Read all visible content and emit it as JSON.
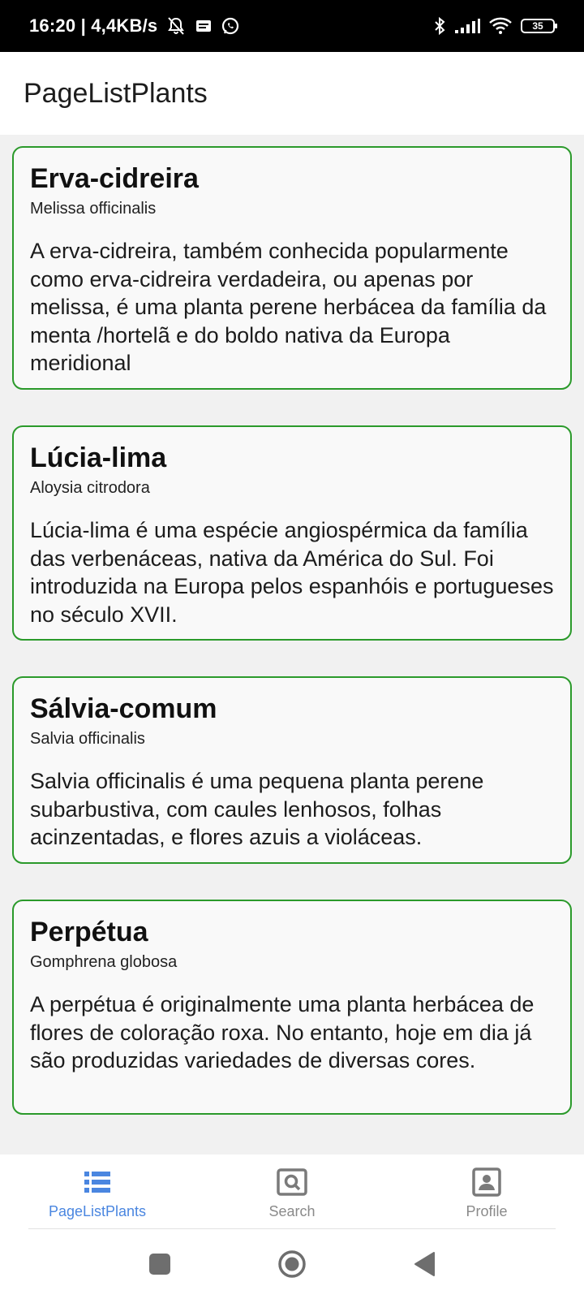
{
  "status_bar": {
    "time_speed": "16:20 | 4,4KB/s",
    "battery_level": "35",
    "icons": [
      "alarm-off-icon",
      "message-icon",
      "whatsapp-icon",
      "bluetooth-icon",
      "signal-icon",
      "wifi-icon",
      "battery-icon"
    ]
  },
  "app_bar": {
    "title": "PageListPlants"
  },
  "colors": {
    "card_border": "#2b9a2b",
    "active_tab": "#4a86e0",
    "inactive_tab": "#8a8a8a"
  },
  "plants": [
    {
      "name": "Erva-cidreira",
      "scientific": "Melissa officinalis",
      "description": "A erva-cidreira, também conhecida popularmente como erva-cidreira verdadeira, ou apenas por melissa, é uma planta perene herbácea da família da menta /hortelã e do boldo nativa da Europa meridional"
    },
    {
      "name": "Lúcia-lima",
      "scientific": "Aloysia citrodora",
      "description": "Lúcia-lima é uma espécie angiospérmica da família das verbenáceas, nativa da América do Sul. Foi introduzida na Europa pelos espanhóis e portugueses no século XVII."
    },
    {
      "name": "Sálvia-comum",
      "scientific": "Salvia officinalis",
      "description": "Salvia officinalis é uma pequena planta perene subarbustiva, com caules lenhosos, folhas acinzentadas, e flores azuis a violáceas."
    },
    {
      "name": "Perpétua",
      "scientific": "Gomphrena globosa",
      "description": "A perpétua é originalmente uma planta herbácea de flores de coloração roxa. No entanto, hoje em dia já são produzidas variedades de diversas cores."
    }
  ],
  "bottom_nav": {
    "items": [
      {
        "label": "PageListPlants",
        "icon": "list-icon",
        "active": true
      },
      {
        "label": "Search",
        "icon": "search-icon",
        "active": false
      },
      {
        "label": "Profile",
        "icon": "profile-icon",
        "active": false
      }
    ]
  },
  "system_nav": {
    "icons": [
      "recents-square-icon",
      "home-circle-icon",
      "back-triangle-icon"
    ]
  }
}
